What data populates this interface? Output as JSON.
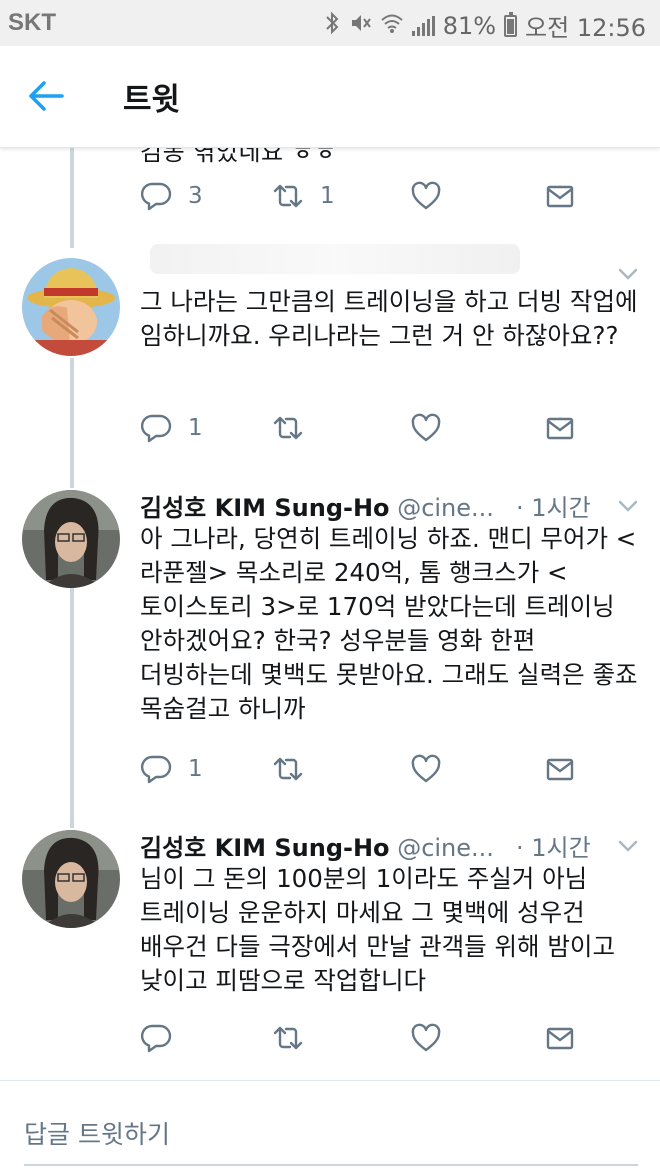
{
  "status_bar": {
    "carrier": "SKT",
    "battery": "81%",
    "battery_level": 0.81,
    "time": "오전 12:56"
  },
  "header": {
    "title": "트윗"
  },
  "previous_tweet": {
    "clipped_text": "김동 엮었네요 ㅎㅎ",
    "replies": "3",
    "retweets": "1",
    "likes": "",
    "messages": ""
  },
  "tweets": [
    {
      "name": "",
      "handle": "",
      "time": "",
      "body": "그 나라는 그만큼의 트레이닝을 하고 더빙 작업에 임하니까요. 우리나라는 그런 거 안 하잖아요??",
      "replies": "1",
      "retweets": "",
      "likes": ""
    },
    {
      "name": "김성호 KIM Sung-Ho",
      "handle": "@cine...",
      "time": "· 1시간",
      "body": "아 그나라, 당연히 트레이닝 하죠. 맨디 무어가 <라푼젤> 목소리로 240억, 톰 행크스가 <토이스토리 3>로 170억 받았다는데 트레이닝 안하겠어요? 한국? 성우분들 영화 한편 더빙하는데 몇백도 못받아요. 그래도 실력은 좋죠 목숨걸고 하니까",
      "replies": "1",
      "retweets": "",
      "likes": ""
    },
    {
      "name": "김성호 KIM Sung-Ho",
      "handle": "@cine...",
      "time": "· 1시간",
      "body": "님이 그 돈의 100분의 1이라도 주실거 아님 트레이닝 운운하지 마세요 그 몇백에 성우건 배우건 다들 극장에서 만날 관객들 위해 밤이고 낮이고 피땀으로 작업합니다",
      "replies": "",
      "retweets": "",
      "likes": ""
    }
  ],
  "reply_bar": {
    "placeholder": "답글 트윗하기"
  },
  "colors": {
    "accent": "#1da1f2",
    "icon_gray": "#657786",
    "thread_line": "#ccd6dd"
  }
}
